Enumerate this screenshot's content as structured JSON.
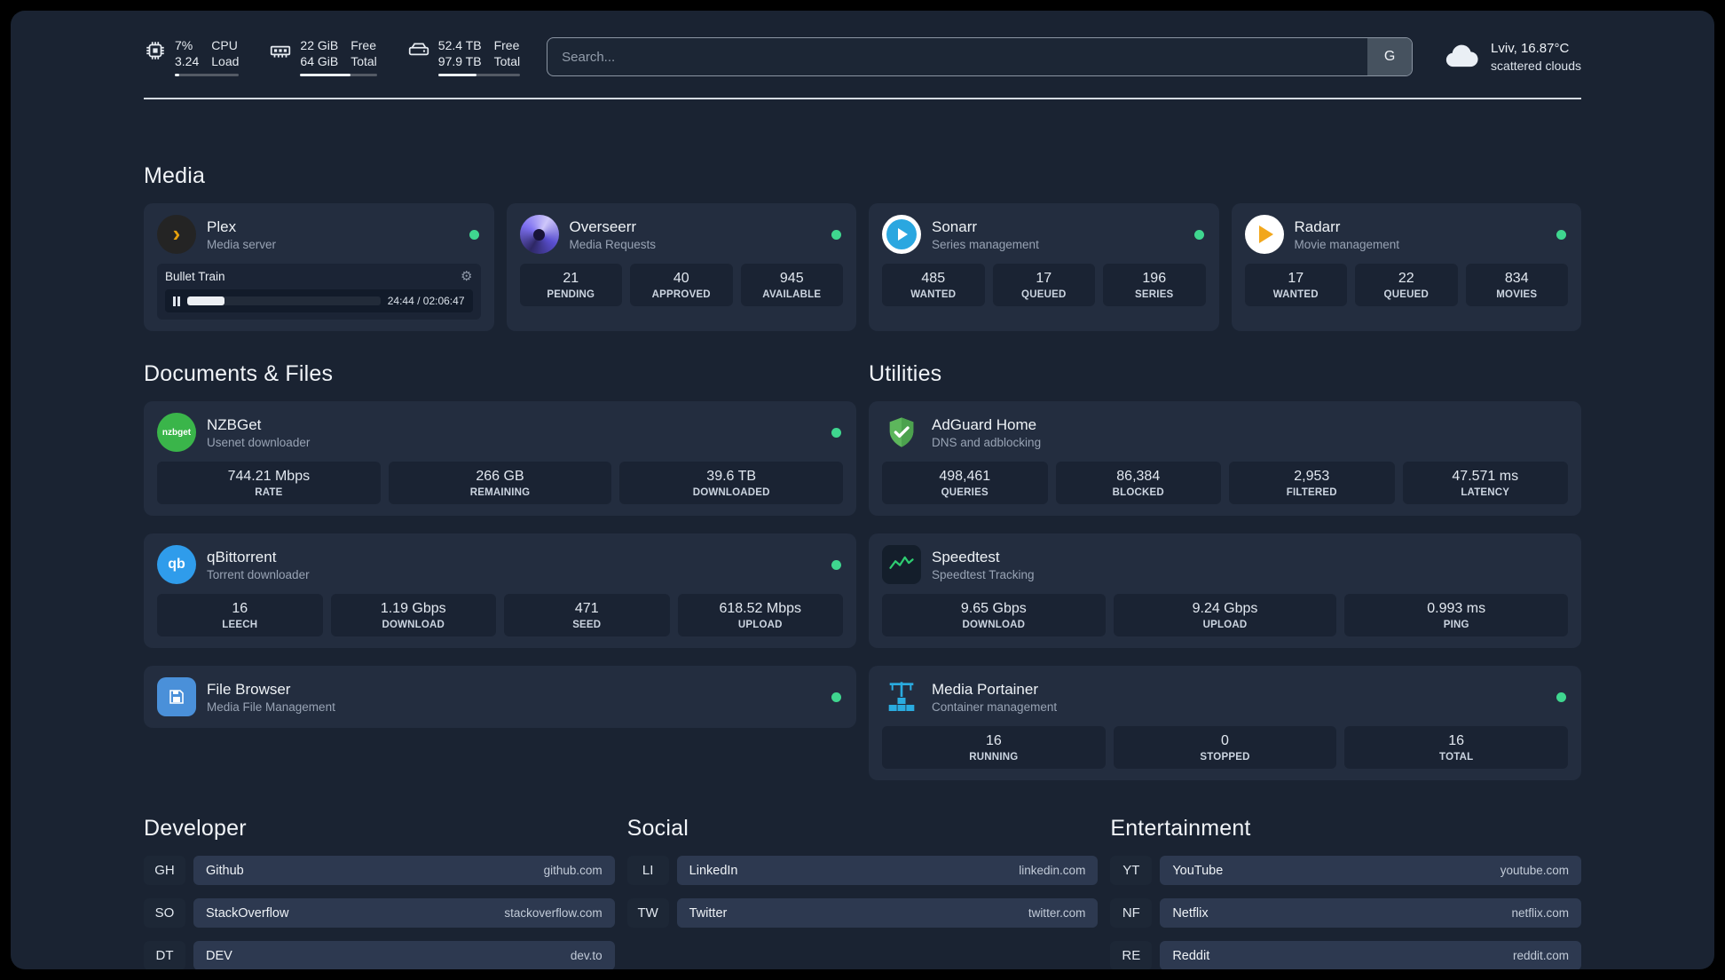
{
  "topbar": {
    "cpu": {
      "value_top": "7%",
      "value_bottom": "3.24",
      "label_top": "CPU",
      "label_bottom": "Load",
      "bar": 7
    },
    "ram": {
      "value_top": "22 GiB",
      "value_bottom": "64 GiB",
      "label_top": "Free",
      "label_bottom": "Total",
      "bar": 66
    },
    "disk": {
      "value_top": "52.4 TB",
      "value_bottom": "97.9 TB",
      "label_top": "Free",
      "label_bottom": "Total",
      "bar": 47
    },
    "search_placeholder": "Search...",
    "search_provider": "G",
    "weather_line1": "Lviv, 16.87°C",
    "weather_line2": "scattered clouds"
  },
  "media": {
    "title": "Media",
    "plex": {
      "name": "Plex",
      "desc": "Media server",
      "now_title": "Bullet Train",
      "time": "24:44 / 02:06:47",
      "progress": 19.5
    },
    "overseerr": {
      "name": "Overseerr",
      "desc": "Media Requests",
      "stats": [
        {
          "value": "21",
          "label": "PENDING"
        },
        {
          "value": "40",
          "label": "APPROVED"
        },
        {
          "value": "945",
          "label": "AVAILABLE"
        }
      ]
    },
    "sonarr": {
      "name": "Sonarr",
      "desc": "Series management",
      "stats": [
        {
          "value": "485",
          "label": "WANTED"
        },
        {
          "value": "17",
          "label": "QUEUED"
        },
        {
          "value": "196",
          "label": "SERIES"
        }
      ]
    },
    "radarr": {
      "name": "Radarr",
      "desc": "Movie management",
      "stats": [
        {
          "value": "17",
          "label": "WANTED"
        },
        {
          "value": "22",
          "label": "QUEUED"
        },
        {
          "value": "834",
          "label": "MOVIES"
        }
      ]
    }
  },
  "documents": {
    "title": "Documents & Files",
    "nzbget": {
      "name": "NZBGet",
      "desc": "Usenet downloader",
      "stats": [
        {
          "value": "744.21 Mbps",
          "label": "RATE"
        },
        {
          "value": "266 GB",
          "label": "REMAINING"
        },
        {
          "value": "39.6 TB",
          "label": "DOWNLOADED"
        }
      ]
    },
    "qbittorrent": {
      "name": "qBittorrent",
      "desc": "Torrent downloader",
      "stats": [
        {
          "value": "16",
          "label": "LEECH"
        },
        {
          "value": "1.19 Gbps",
          "label": "DOWNLOAD"
        },
        {
          "value": "471",
          "label": "SEED"
        },
        {
          "value": "618.52 Mbps",
          "label": "UPLOAD"
        }
      ]
    },
    "filebrowser": {
      "name": "File Browser",
      "desc": "Media File Management"
    }
  },
  "utilities": {
    "title": "Utilities",
    "adguard": {
      "name": "AdGuard Home",
      "desc": "DNS and adblocking",
      "stats": [
        {
          "value": "498,461",
          "label": "QUERIES"
        },
        {
          "value": "86,384",
          "label": "BLOCKED"
        },
        {
          "value": "2,953",
          "label": "FILTERED"
        },
        {
          "value": "47.571 ms",
          "label": "LATENCY"
        }
      ]
    },
    "speedtest": {
      "name": "Speedtest",
      "desc": "Speedtest Tracking",
      "stats": [
        {
          "value": "9.65 Gbps",
          "label": "DOWNLOAD"
        },
        {
          "value": "9.24 Gbps",
          "label": "UPLOAD"
        },
        {
          "value": "0.993 ms",
          "label": "PING"
        }
      ]
    },
    "portainer": {
      "name": "Media Portainer",
      "desc": "Container management",
      "stats": [
        {
          "value": "16",
          "label": "RUNNING"
        },
        {
          "value": "0",
          "label": "STOPPED"
        },
        {
          "value": "16",
          "label": "TOTAL"
        }
      ]
    }
  },
  "bookmarks": {
    "developer": {
      "title": "Developer",
      "items": [
        {
          "abbr": "GH",
          "name": "Github",
          "url": "github.com"
        },
        {
          "abbr": "SO",
          "name": "StackOverflow",
          "url": "stackoverflow.com"
        },
        {
          "abbr": "DT",
          "name": "DEV",
          "url": "dev.to"
        }
      ]
    },
    "social": {
      "title": "Social",
      "items": [
        {
          "abbr": "LI",
          "name": "LinkedIn",
          "url": "linkedin.com"
        },
        {
          "abbr": "TW",
          "name": "Twitter",
          "url": "twitter.com"
        }
      ]
    },
    "entertainment": {
      "title": "Entertainment",
      "items": [
        {
          "abbr": "YT",
          "name": "YouTube",
          "url": "youtube.com"
        },
        {
          "abbr": "NF",
          "name": "Netflix",
          "url": "netflix.com"
        },
        {
          "abbr": "RE",
          "name": "Reddit",
          "url": "reddit.com"
        }
      ]
    }
  }
}
